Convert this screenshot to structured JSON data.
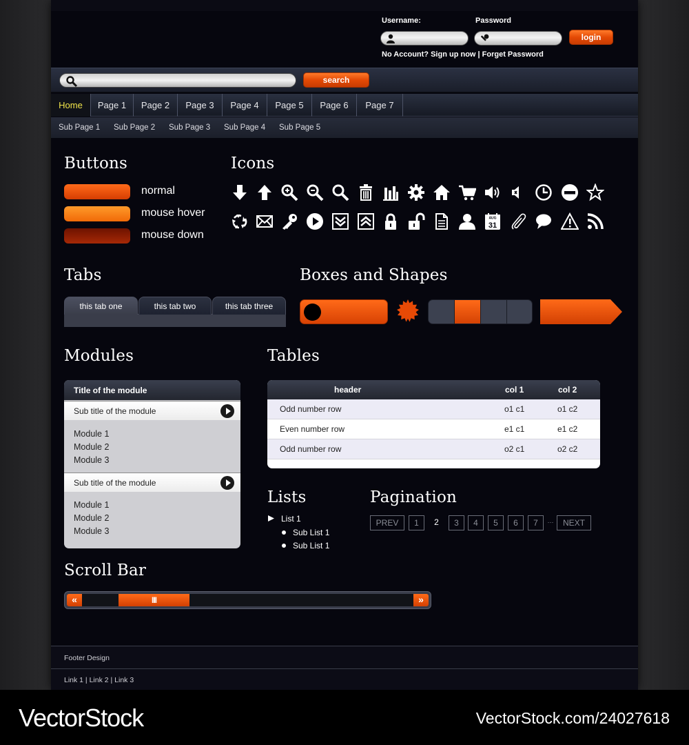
{
  "login": {
    "username_label": "Username:",
    "password_label": "Password",
    "login_button": "login",
    "signup_text": "No Account? Sign up now | Forget Password"
  },
  "search": {
    "button": "search"
  },
  "nav": {
    "items": [
      "Home",
      "Page 1",
      "Page 2",
      "Page 3",
      "Page 4",
      "Page 5",
      "Page 6",
      "Page 7"
    ],
    "active": "Home"
  },
  "subnav": {
    "items": [
      "Sub Page 1",
      "Sub Page 2",
      "Sub Page 3",
      "Sub Page 4",
      "Sub Page 5"
    ]
  },
  "sections": {
    "buttons": "Buttons",
    "icons": "Icons",
    "tabs": "Tabs",
    "shapes": "Boxes and Shapes",
    "modules": "Modules",
    "tables": "Tables",
    "lists": "Lists",
    "pagination": "Pagination",
    "scrollbar": "Scroll Bar"
  },
  "buttons": {
    "normal": "normal",
    "hover": "mouse hover",
    "down": "mouse down",
    "colors": {
      "normal": "#e84a06",
      "hover": "#ff7a12",
      "down": "#8e1a02"
    }
  },
  "icons": {
    "row1": [
      "arrow-down-icon",
      "arrow-up-icon",
      "zoom-in-icon",
      "zoom-out-icon",
      "search-icon",
      "trash-icon",
      "bar-chart-icon",
      "gear-icon",
      "home-icon",
      "cart-icon",
      "volume-icon",
      "mute-icon",
      "clock-icon",
      "no-entry-icon",
      "star-icon"
    ],
    "row2": [
      "recycle-icon",
      "mail-icon",
      "key-icon",
      "play-icon",
      "double-down-icon",
      "double-up-icon",
      "lock-icon",
      "unlock-icon",
      "document-icon",
      "user-icon",
      "calendar-icon",
      "paperclip-icon",
      "chat-icon",
      "warning-icon",
      "rss-icon"
    ],
    "calendar_month": "AUG",
    "calendar_day": "31"
  },
  "tabs": {
    "items": [
      "this tab one",
      "this tab two",
      "this tab three"
    ],
    "active": 0
  },
  "modules": {
    "title": "Title of the module",
    "groups": [
      {
        "subtitle": "Sub title of the module",
        "items": [
          "Module 1",
          "Module 2",
          "Module 3"
        ]
      },
      {
        "subtitle": "Sub title of the module",
        "items": [
          "Module 1",
          "Module 2",
          "Module 3"
        ]
      }
    ]
  },
  "table": {
    "headers": [
      "header",
      "col 1",
      "col 2"
    ],
    "rows": [
      [
        "Odd number row",
        "o1 c1",
        "o1 c2"
      ],
      [
        "Even number row",
        "e1 c1",
        "e1 c2"
      ],
      [
        "Odd number row",
        "o2 c1",
        "o2 c2"
      ]
    ]
  },
  "lists": {
    "item": "List 1",
    "sub_items": [
      "Sub List 1",
      "Sub List 1"
    ]
  },
  "pagination": {
    "prev": "PREV",
    "next": "NEXT",
    "pages": [
      "1",
      "2",
      "3",
      "4",
      "5",
      "6",
      "7"
    ],
    "current": "2",
    "ellipsis": "···"
  },
  "scrollbar": {
    "left_arrow": "«",
    "right_arrow": "»",
    "thumb_grip": "III",
    "position": 0.22
  },
  "footer": {
    "title": "Footer Design",
    "links": "Link 1 | Link 2 | Link 3"
  },
  "watermark": {
    "logo": "VectorStock",
    "url": "VectorStock.com/24027618"
  },
  "colors": {
    "accent": "#e84a06",
    "background": "#06060e",
    "active_nav": "#f2e64a"
  }
}
